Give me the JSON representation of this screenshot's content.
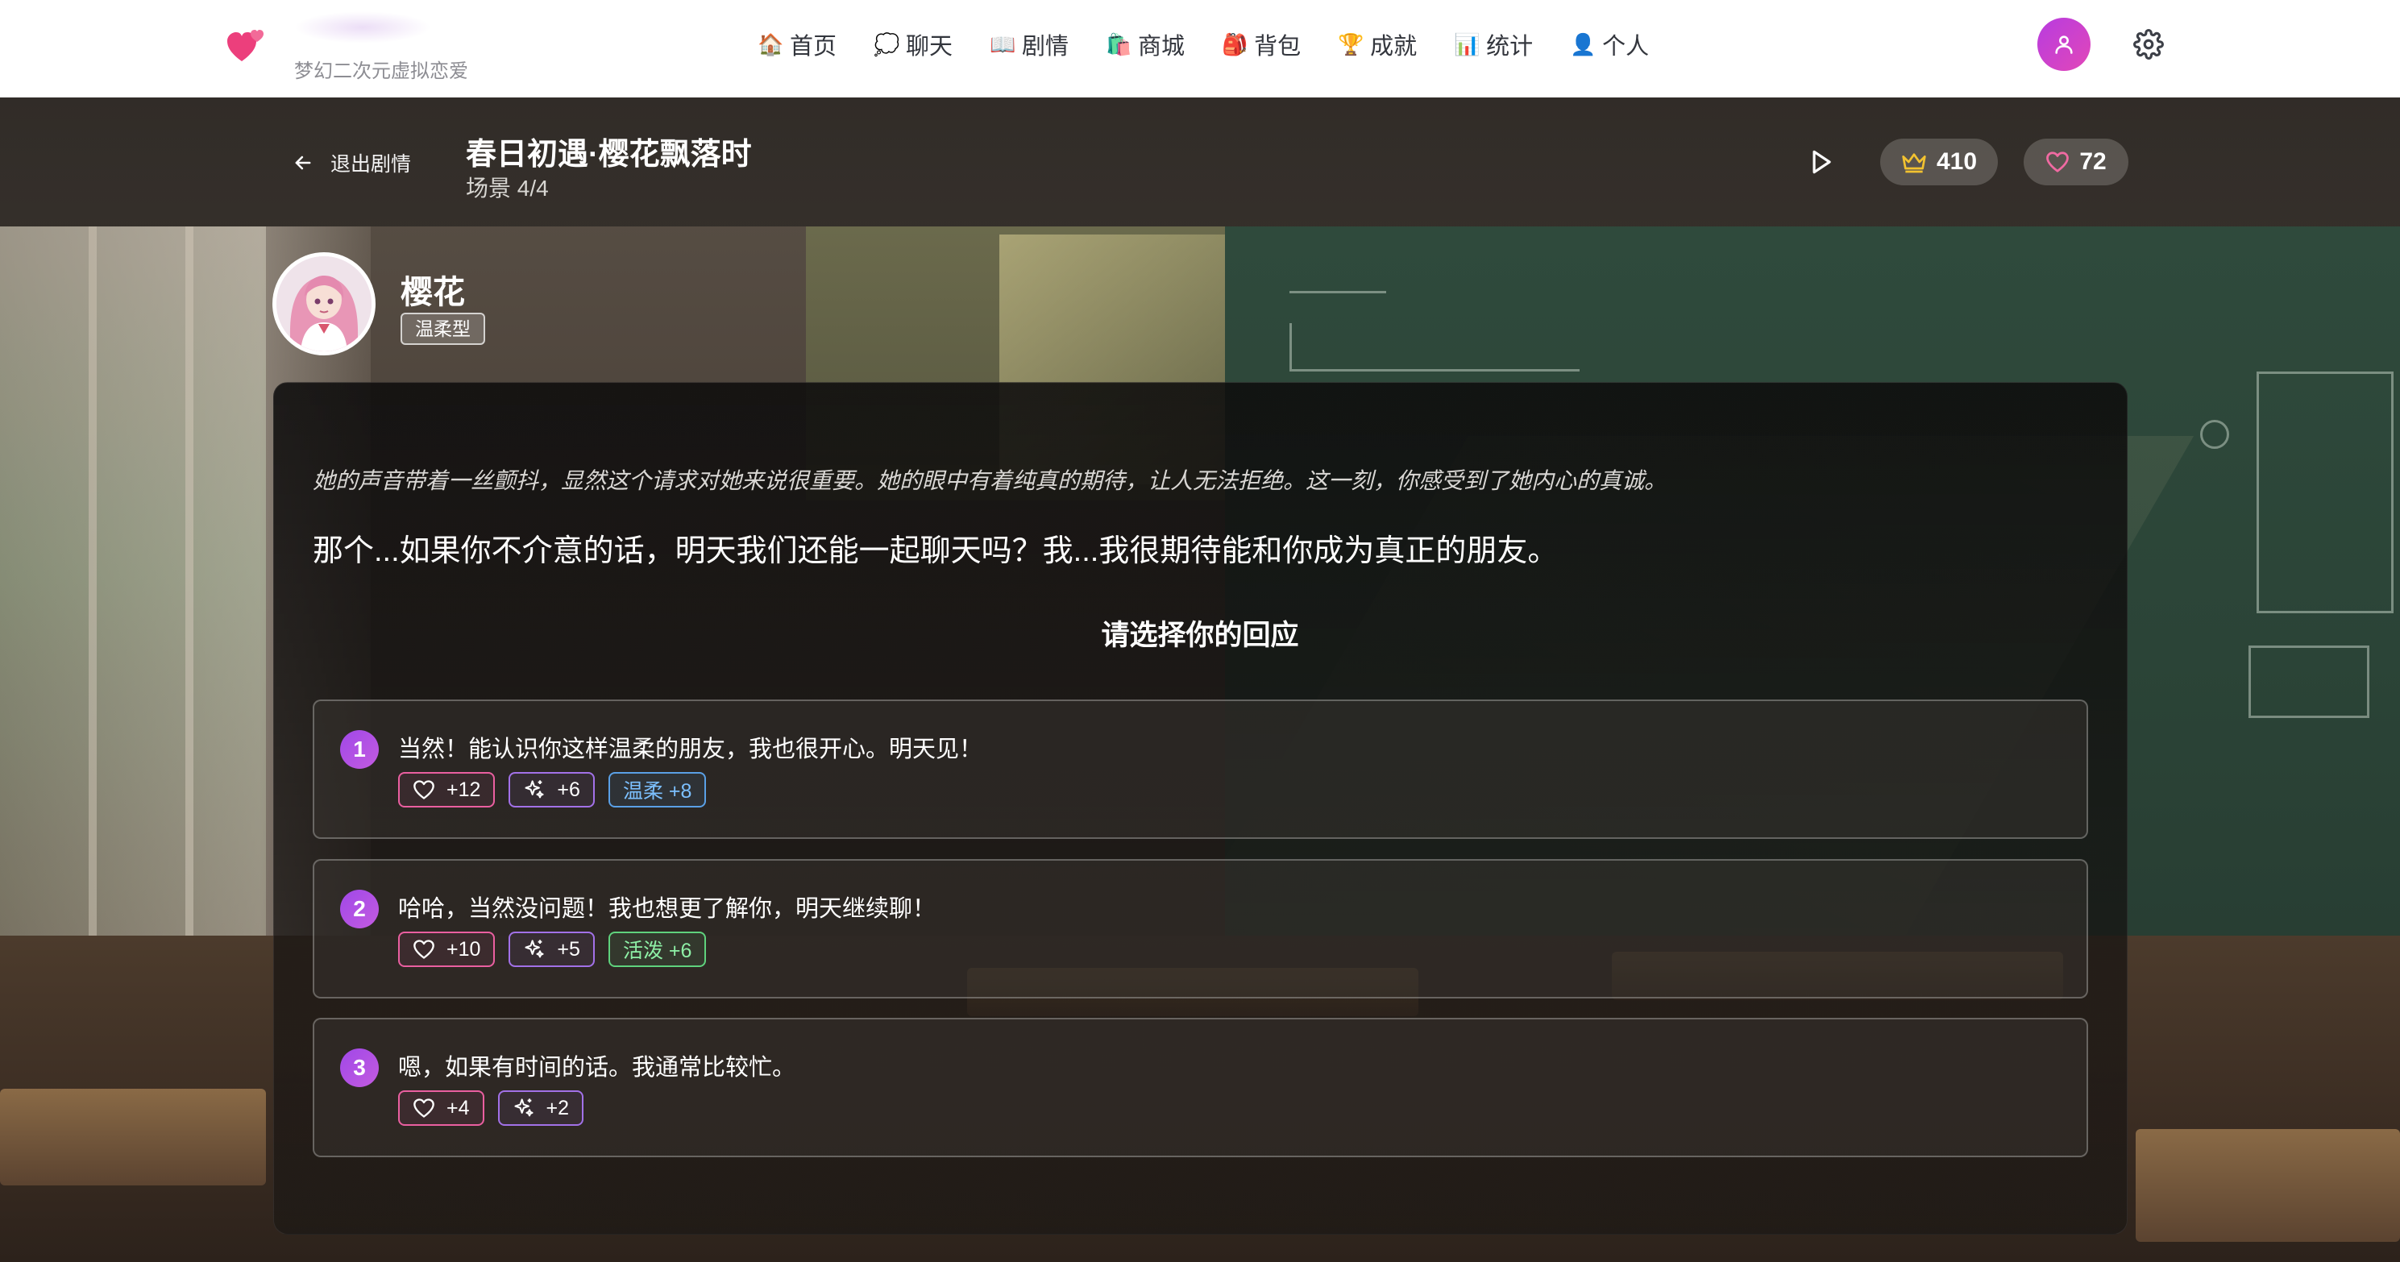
{
  "nav": {
    "app_subtitle": "梦幻二次元虚拟恋爱",
    "items": [
      {
        "icon": "house-icon",
        "glyph": "🏠",
        "label": "首页"
      },
      {
        "icon": "speech-bubble-icon",
        "glyph": "💭",
        "label": "聊天"
      },
      {
        "icon": "book-icon",
        "glyph": "📖",
        "label": "剧情"
      },
      {
        "icon": "shopping-bags-icon",
        "glyph": "🛍️",
        "label": "商城"
      },
      {
        "icon": "backpack-icon",
        "glyph": "🎒",
        "label": "背包"
      },
      {
        "icon": "trophy-icon",
        "glyph": "🏆",
        "label": "成就"
      },
      {
        "icon": "bar-chart-icon",
        "glyph": "📊",
        "label": "统计"
      },
      {
        "icon": "person-icon",
        "glyph": "👤",
        "label": "个人"
      }
    ]
  },
  "story": {
    "exit_label": "退出剧情",
    "title": "春日初遇·樱花飘落时",
    "scene": "场景 4/4",
    "crown_count": "410",
    "heart_count": "72"
  },
  "character": {
    "name": "樱花",
    "personality": "温柔型"
  },
  "dialogue": {
    "narration": "她的声音带着一丝颤抖，显然这个请求对她来说很重要。她的眼中有着纯真的期待，让人无法拒绝。这一刻，你感受到了她内心的真诚。",
    "speech": "那个...如果你不介意的话，明天我们还能一起聊天吗？我...我很期待能和你成为真正的朋友。",
    "choose_prompt": "请选择你的回应"
  },
  "choices": [
    {
      "number": "1",
      "text": "当然！能认识你这样温柔的朋友，我也很开心。明天见！",
      "affection": "+12",
      "sparkle": "+6",
      "trait": "温柔 +8",
      "trait_color": "blue"
    },
    {
      "number": "2",
      "text": "哈哈，当然没问题！我也想更了解你，明天继续聊！",
      "affection": "+10",
      "sparkle": "+5",
      "trait": "活泼 +6",
      "trait_color": "green"
    },
    {
      "number": "3",
      "text": "嗯，如果有时间的话。我通常比较忙。",
      "affection": "+4",
      "sparkle": "+2"
    }
  ],
  "colors": {
    "accent_purple": "#a048e8",
    "affection_pink": "#ea5fa0",
    "sparkle_purple": "#a271e8",
    "trait_blue": "#5aa0e6",
    "trait_green": "#5fd27d",
    "crown_gold": "#f2c230"
  }
}
